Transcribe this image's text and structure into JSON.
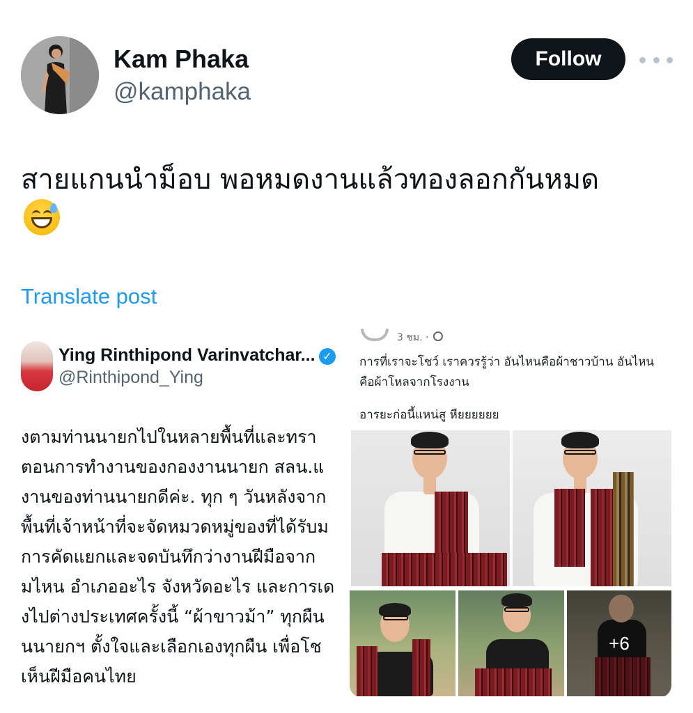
{
  "author": {
    "name": "Kam Phaka",
    "handle": "@kamphaka",
    "follow_label": "Follow"
  },
  "post": {
    "text": "สายแกนนำม็อบ พอหมดงานแล้วทองลอกกันหมด",
    "emoji": "grinning-face-with-sweat",
    "translate_label": "Translate post"
  },
  "embedded_tweet": {
    "name": "Ying Rinthipond Varinvatchar...",
    "handle": "@Rinthipond_Ying",
    "lines": [
      "ุ่งตามท่านนายกไปในหลายพื้นที่และทรา",
      "ตอนการทำงานของกองงานนายก สลน.แ",
      "งานของท่านนายกดีค่ะ. ทุก ๆ วันหลังจาก",
      "พื้นที่เจ้าหน้าที่จะจัดหมวดหมู่ของที่ได้รับม",
      "ัีการคัดแยกและจดบันทึกว่างานฝีมือจาก",
      "มไหน อำเภออะไร จังหวัดอะไร และการเด",
      "งไปต่างประเทศครั้งนี้ “ผ้าขาวม้า” ทุกผืน",
      "นนายกฯ ตั้งใจและเลือกเองทุกผืน เพื่อโช",
      "เห็นฝีมือคนไทย"
    ]
  },
  "facebook_post": {
    "time": "3 ชม. ·",
    "text": "การที่เราจะโชว์ เราควรรู้ว่า อันไหนคือผ้าชาวบ้าน อันไหนคือผ้าโหลจากโรงงาน",
    "text2": "อารยะก่อนี้แหน่สู หียยยยยย",
    "more_photos": "+6"
  }
}
